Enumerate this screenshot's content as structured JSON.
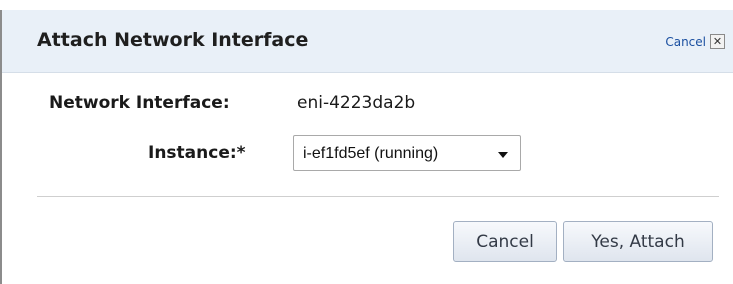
{
  "dialog": {
    "title": "Attach Network Interface",
    "close_label": "Cancel",
    "close_icon": "close-icon"
  },
  "form": {
    "network_interface_label": "Network Interface:",
    "network_interface_value": "eni-4223da2b",
    "instance_label": "Instance:*",
    "instance_selected": "i-ef1fd5ef (running)"
  },
  "footer": {
    "cancel_label": "Cancel",
    "confirm_label": "Yes, Attach"
  },
  "colors": {
    "header_bg": "#e9f0f8",
    "link": "#1a4fa0",
    "button_border": "#a3b0c2"
  }
}
